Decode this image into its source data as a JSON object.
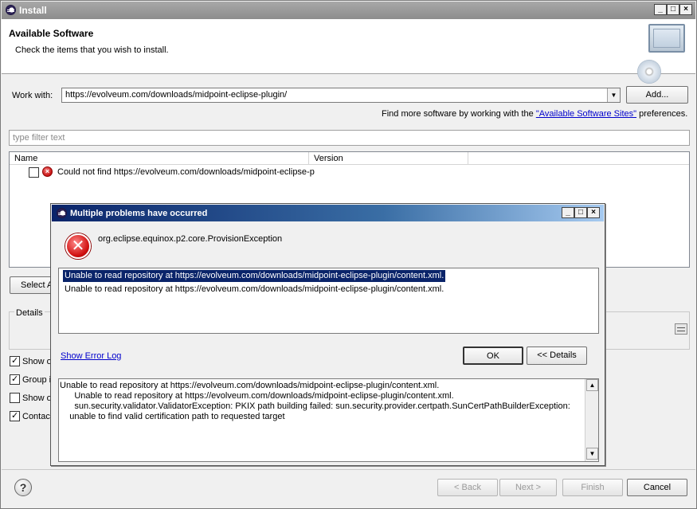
{
  "window": {
    "title": "Install",
    "controls": [
      "_",
      "□",
      "×"
    ]
  },
  "header": {
    "title": "Available Software",
    "subtitle": "Check the items that you wish to install."
  },
  "work_with": {
    "label": "Work with:",
    "value": "https://evolveum.com/downloads/midpoint-eclipse-plugin/",
    "add_button": "Add...",
    "find_more_prefix": "Find more software by working with the ",
    "find_more_link": "\"Available Software Sites\"",
    "find_more_suffix": " preferences."
  },
  "filter": {
    "placeholder": "type filter text"
  },
  "table": {
    "columns": [
      "Name",
      "Version"
    ],
    "rows": [
      {
        "checked": false,
        "name": "Could not find https://evolveum.com/downloads/midpoint-eclipse-p"
      }
    ]
  },
  "select_all_label": "Select A",
  "details_label": "Details",
  "options": [
    {
      "label": "Show o",
      "checked": true
    },
    {
      "label": "Group it",
      "checked": true
    },
    {
      "label": "Show o",
      "checked": false
    },
    {
      "label": "Contact",
      "checked": true
    }
  ],
  "footer": {
    "help": "?",
    "back": "< Back",
    "next": "Next >",
    "finish": "Finish",
    "cancel": "Cancel"
  },
  "dialog": {
    "title": "Multiple problems have occurred",
    "exception": "org.eclipse.equinox.p2.core.ProvisionException",
    "list": [
      "Unable to read repository at https://evolveum.com/downloads/midpoint-eclipse-plugin/content.xml.",
      "Unable to read repository at https://evolveum.com/downloads/midpoint-eclipse-plugin/content.xml."
    ],
    "show_error_log": "Show Error Log",
    "ok": "OK",
    "details_button": "<< Details",
    "details_text": "Unable to read repository at https://evolveum.com/downloads/midpoint-eclipse-plugin/content.xml.\n      Unable to read repository at https://evolveum.com/downloads/midpoint-eclipse-plugin/content.xml.\n      sun.security.validator.ValidatorException: PKIX path building failed: sun.security.provider.certpath.SunCertPathBuilderException:\n    unable to find valid certification path to requested target"
  }
}
